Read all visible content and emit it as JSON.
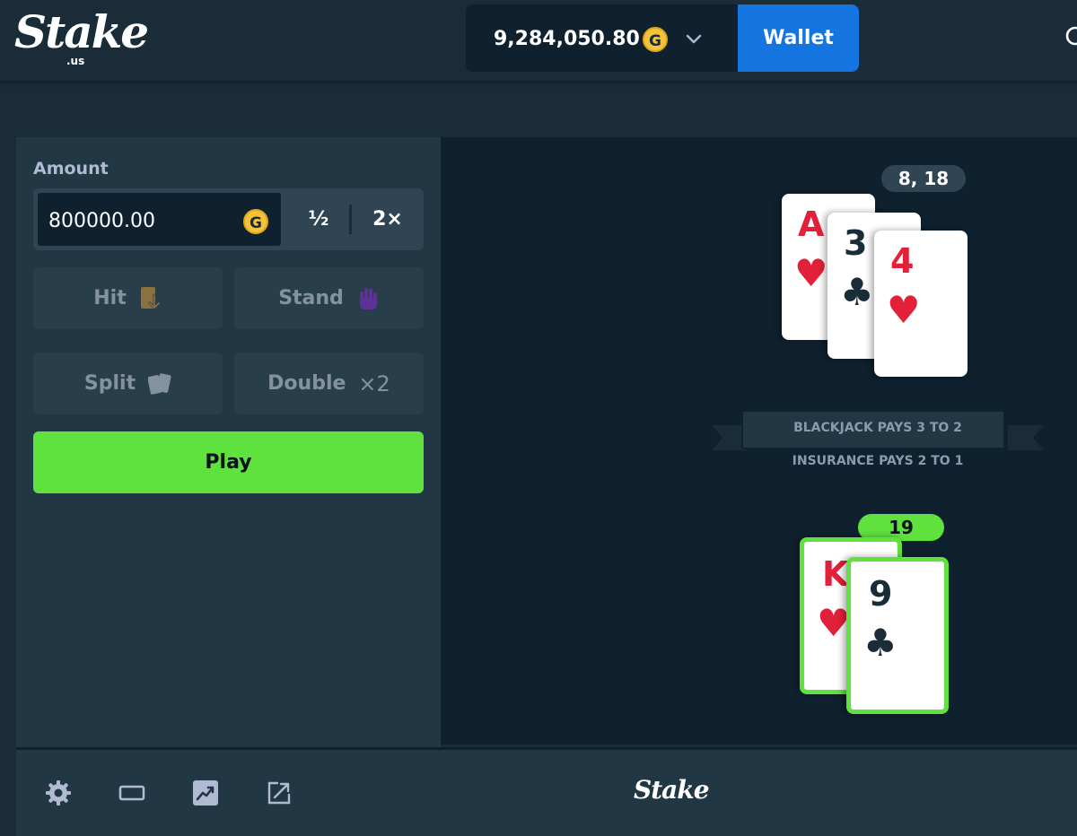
{
  "brand": {
    "logo_text": "Stake",
    "logo_sub": ".us",
    "footer_logo": "Stake"
  },
  "header": {
    "balance": "9,284,050.80",
    "currency_symbol": "G",
    "wallet_label": "Wallet",
    "icons": [
      "chevron-down-icon",
      "search-icon"
    ]
  },
  "controls": {
    "amount_label": "Amount",
    "amount_value": "800000.00",
    "half_label": "½",
    "double_label": "2×",
    "hit_label": "Hit",
    "stand_label": "Stand",
    "split_label": "Split",
    "double_down_label": "Double",
    "double_down_mult": "×2",
    "play_label": "Play"
  },
  "table": {
    "dealer_score": "8, 18",
    "player_score": "19",
    "rule_1": "BLACKJACK PAYS 3 TO 2",
    "rule_2": "INSURANCE PAYS 2 TO 1",
    "dealer_cards": [
      {
        "rank": "A",
        "suit": "♥"
      },
      {
        "rank": "3",
        "suit": "♣"
      },
      {
        "rank": "4",
        "suit": "♥"
      }
    ],
    "player_cards": [
      {
        "rank": "K",
        "suit": "♥"
      },
      {
        "rank": "9",
        "suit": "♣"
      }
    ]
  },
  "footer": {
    "icons": [
      "gear-icon",
      "theatre-mode-icon",
      "live-stats-icon",
      "popout-icon"
    ]
  },
  "colors": {
    "background": "#1a2c38",
    "panel": "#213743",
    "table": "#0f212e",
    "wallet_blue": "#1475e1",
    "play_green": "#5fe23e",
    "card_red": "#e2203a"
  }
}
